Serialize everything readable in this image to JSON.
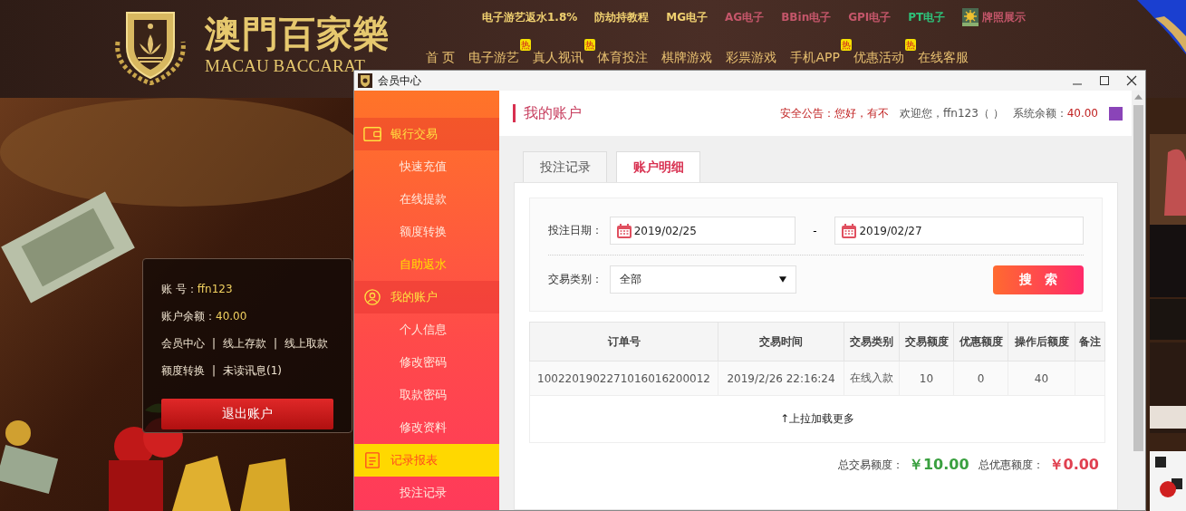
{
  "header": {
    "logo_title": "澳門百家樂",
    "logo_subtitle": "MACAU BACCARAT",
    "top_links": [
      {
        "kind": "text",
        "label": "电子游艺返水1.8%",
        "color": "#f0d070"
      },
      {
        "kind": "text",
        "label": "防劫持教程",
        "color": "#f0d070"
      },
      {
        "kind": "text",
        "label": "MG电子",
        "color": "#f0d070"
      },
      {
        "kind": "text",
        "label": "AG电子",
        "color": "#c4566a"
      },
      {
        "kind": "text",
        "label": "BBin电子",
        "color": "#c4566a"
      },
      {
        "kind": "text",
        "label": "GPI电子",
        "color": "#c4566a"
      },
      {
        "kind": "text",
        "label": "PT电子",
        "color": "#2ec27a"
      },
      {
        "kind": "license",
        "label": "牌照展示",
        "color": "#c4566a"
      }
    ],
    "nav": [
      {
        "label": "首 页"
      },
      {
        "label": "电子游艺",
        "badge": "热"
      },
      {
        "label": "真人视讯",
        "badge": "热"
      },
      {
        "label": "体育投注"
      },
      {
        "label": "棋牌游戏"
      },
      {
        "label": "彩票游戏"
      },
      {
        "label": "手机APP",
        "badge": "热"
      },
      {
        "label": "优惠活动",
        "badge": "热"
      },
      {
        "label": "在线客服"
      }
    ]
  },
  "account_card": {
    "fields": [
      {
        "label": "账 号：",
        "value": "ffn123"
      },
      {
        "label": "账户余额：",
        "value": "40.00"
      }
    ],
    "link_rows": [
      [
        "会员中心",
        "线上存款",
        "线上取款"
      ],
      [
        "额度转换",
        "未读讯息(1)"
      ]
    ],
    "separator": "|",
    "logout_button": "退出账户"
  },
  "window": {
    "title": "会员中心",
    "sidebar": [
      {
        "label": "银行交易",
        "selected": false,
        "items": [
          {
            "label": "快速充值",
            "selected": false
          },
          {
            "label": "在线提款",
            "selected": false
          },
          {
            "label": "额度转换",
            "selected": false
          },
          {
            "label": "自助返水",
            "selected": true
          }
        ]
      },
      {
        "label": "我的账户",
        "selected": false,
        "items": [
          {
            "label": "个人信息",
            "selected": false
          },
          {
            "label": "修改密码",
            "selected": false
          },
          {
            "label": "取款密码",
            "selected": false
          },
          {
            "label": "修改资料",
            "selected": false
          }
        ]
      },
      {
        "label": "记录报表",
        "selected": true,
        "items": [
          {
            "label": "投注记录",
            "selected": false
          }
        ]
      }
    ],
    "page_title": "我的账户",
    "notice": "安全公告：您好，有不",
    "welcome": "欢迎您，ffn123（ ）",
    "balance_label": "系统余额：",
    "balance": "40.00",
    "tabs": [
      {
        "label": "投注记录",
        "selected": false
      },
      {
        "label": "账户明细",
        "selected": true
      }
    ],
    "filters": {
      "date_label": "投注日期：",
      "date_from": "2019/02/25",
      "separator": "-",
      "date_to": "2019/02/27",
      "type_label": "交易类别：",
      "type_value": "全部",
      "search_button": "搜　索"
    },
    "table": {
      "columns": [
        "订单号",
        "交易时间",
        "交易类别",
        "交易额度",
        "优惠额度",
        "操作后额度",
        "备注"
      ],
      "rows": [
        [
          "1002201902271016016200012",
          "2019/2/26 22:16:24",
          "在线入款",
          "10",
          "0",
          "40",
          ""
        ]
      ],
      "load_more": "↑上拉加载更多"
    },
    "totals": {
      "trade_label": "总交易额度：",
      "trade_value": "￥10.00",
      "bonus_label": "总优惠额度：",
      "bonus_value": "￥0.00"
    }
  }
}
